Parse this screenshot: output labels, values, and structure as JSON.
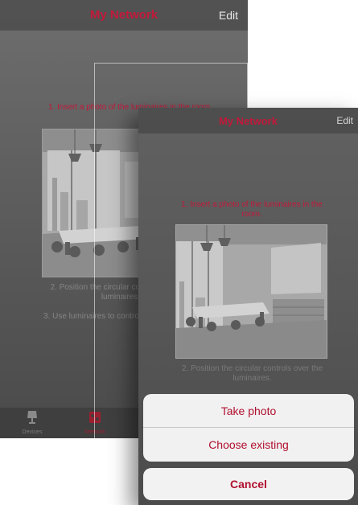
{
  "back": {
    "title": "My Network",
    "edit": "Edit",
    "step1": "1. Insert a photo of the luminaires in the room.",
    "step2": "2. Position the circular controls over the luminaires.",
    "step3": "3. Use luminaires to control the lights.",
    "tabs": [
      {
        "label": "Devices",
        "icon": "lamp-icon"
      },
      {
        "label": "Network",
        "icon": "network-icon"
      }
    ]
  },
  "front": {
    "title": "My Network",
    "edit": "Edit",
    "step1": "1. Insert a photo of the luminaires in the room.",
    "step2": "2. Position the circular controls over the luminaires.",
    "photo": "meeting-room-photo"
  },
  "action_sheet": {
    "take_photo": "Take photo",
    "choose_existing": "Choose existing",
    "cancel": "Cancel"
  },
  "colors": {
    "accent": "#c2193a",
    "sheet_text": "#b0102e"
  }
}
